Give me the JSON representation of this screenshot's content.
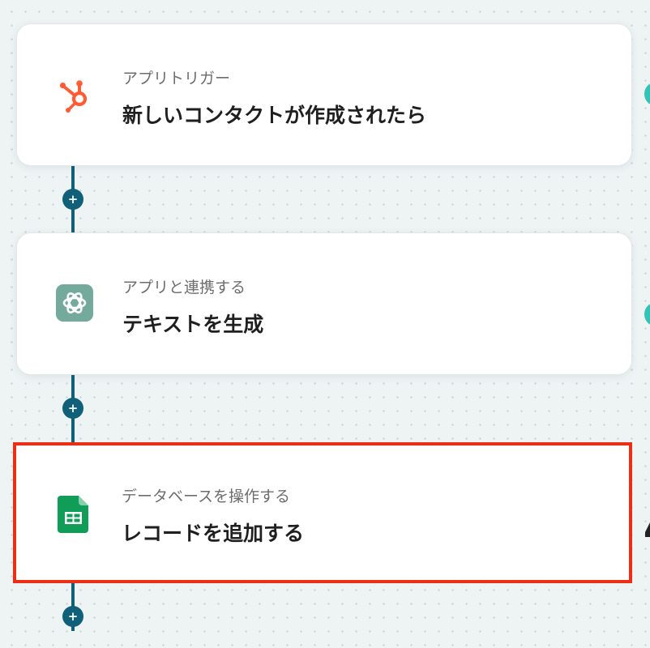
{
  "steps": [
    {
      "category": "アプリトリガー",
      "title": "新しいコンタクトが作成されたら",
      "icon": "hubspot-icon"
    },
    {
      "category": "アプリと連携する",
      "title": "テキストを生成",
      "icon": "chatgpt-icon"
    },
    {
      "category": "データベースを操作する",
      "title": "レコードを追加する",
      "icon": "google-sheets-icon",
      "selected": true
    }
  ],
  "add_button_glyph": "+",
  "colors": {
    "connector": "#11607a",
    "selected_border": "#ec2f14",
    "hubspot": "#ff5c35",
    "chatgpt": "#74aa9c",
    "sheets": "#0f9d58",
    "side_indicator": "#2ec4b6"
  }
}
